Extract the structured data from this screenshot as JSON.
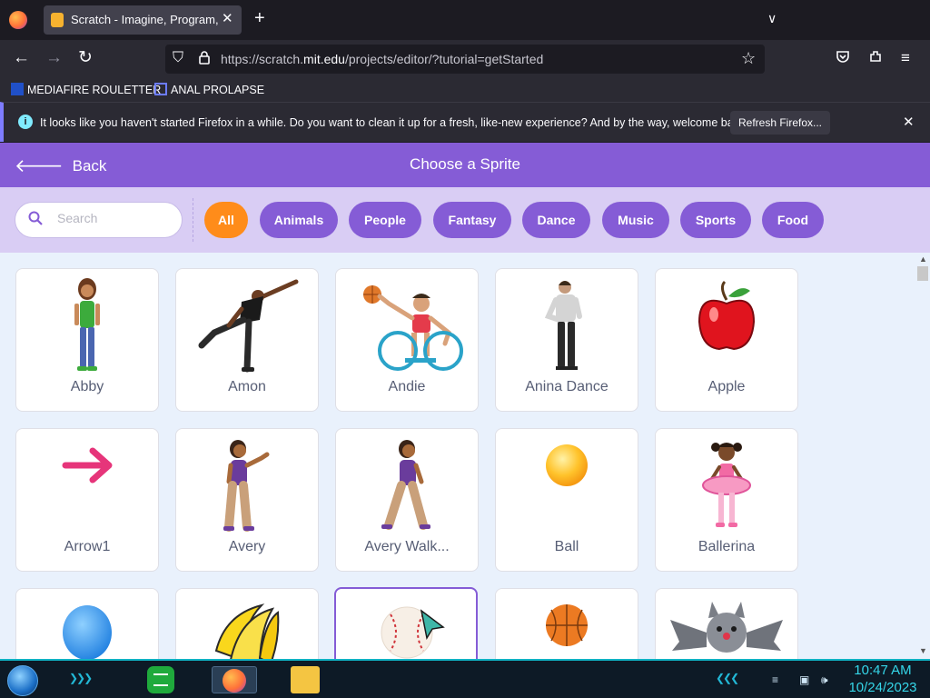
{
  "browser": {
    "tab_title": "Scratch - Imagine, Program, Sh",
    "url_prefix": "https://scratch.",
    "url_host": "mit.edu",
    "url_rest": "/projects/editor/?tutorial=getStarted",
    "bookmarks": [
      "MEDIAFIRE ROULETTER",
      "ANAL PROLAPSE"
    ],
    "notification": {
      "text": "It looks like you haven't started Firefox in a while. Do you want to clean it up for a fresh, like-new experience? And by the way, welcome back!",
      "button": "Refresh Firefox..."
    }
  },
  "library": {
    "back_label": "Back",
    "title": "Choose a Sprite",
    "search_placeholder": "Search",
    "tags": [
      "All",
      "Animals",
      "People",
      "Fantasy",
      "Dance",
      "Music",
      "Sports",
      "Food"
    ],
    "active_tag": "All",
    "sprites": [
      {
        "name": "Abby",
        "icon": "girl-standing"
      },
      {
        "name": "Amon",
        "icon": "man-dancing"
      },
      {
        "name": "Andie",
        "icon": "wheelchair-basketball"
      },
      {
        "name": "Anina Dance",
        "icon": "woman-dancing"
      },
      {
        "name": "Apple",
        "icon": "red-apple"
      },
      {
        "name": "Arrow1",
        "icon": "pink-arrow"
      },
      {
        "name": "Avery",
        "icon": "girl-waving"
      },
      {
        "name": "Avery Walk...",
        "icon": "girl-walking"
      },
      {
        "name": "Ball",
        "icon": "yellow-ball"
      },
      {
        "name": "Ballerina",
        "icon": "ballerina"
      },
      {
        "name": "",
        "icon": "blue-balloon"
      },
      {
        "name": "",
        "icon": "bananas"
      },
      {
        "name": "",
        "icon": "baseball"
      },
      {
        "name": "",
        "icon": "basketball"
      },
      {
        "name": "",
        "icon": "bat"
      }
    ]
  },
  "taskbar": {
    "time": "10:47 AM",
    "date": "10/24/2023"
  },
  "colors": {
    "scratch_purple": "#855cd6",
    "active_tag": "#ff8c1a",
    "filter_bg": "#d9cdf4",
    "grid_bg": "#e9f1fc"
  }
}
